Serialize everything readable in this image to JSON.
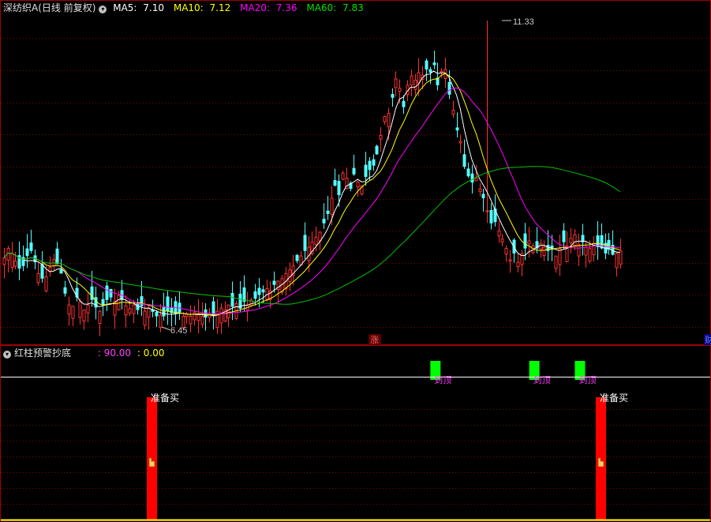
{
  "main_panel": {
    "title": "深纺织A(日线 前复权)",
    "ma_labels": [
      {
        "label": "MA5:",
        "value": "7.10",
        "color": "#ffffff"
      },
      {
        "label": "MA10:",
        "value": "7.12",
        "color": "#ffff00"
      },
      {
        "label": "MA20:",
        "value": "7.36",
        "color": "#ff00ff"
      },
      {
        "label": "MA60:",
        "value": "7.83",
        "color": "#00e000"
      }
    ],
    "high_marker": "11.33",
    "low_marker": "6.45",
    "zhang_label": "涨",
    "edge_label": "财"
  },
  "indicator_panel": {
    "title": "红柱预警抄底",
    "value1": ": 90.00",
    "value2": ": 0.00",
    "signal_top_label": "到顶",
    "signal_buy_label": "准备买"
  },
  "colors": {
    "up": "#ff3232",
    "down": "#54ffff",
    "ma5": "#ffffff",
    "ma10": "#ffff00",
    "ma20": "#ff00ff",
    "ma60": "#00c000",
    "grid": "#8b0000",
    "buy_bar": "#ff0000",
    "top_box": "#00ff00",
    "top_text": "#ff40ff"
  },
  "chart_data": {
    "type": "candlestick",
    "title": "深纺织A(日线 前复权)",
    "ylim": [
      6.2,
      11.6
    ],
    "close_series": [
      7.55,
      7.7,
      7.62,
      7.5,
      7.38,
      7.42,
      7.58,
      7.66,
      7.48,
      7.3,
      7.22,
      7.25,
      7.4,
      7.52,
      7.45,
      7.3,
      6.98,
      6.8,
      6.78,
      6.92,
      6.85,
      6.72,
      6.8,
      6.88,
      6.76,
      6.7,
      6.8,
      6.88,
      6.92,
      6.86,
      6.95,
      6.88,
      6.79,
      6.74,
      6.8,
      6.72,
      6.78,
      6.7,
      6.75,
      6.69,
      6.62,
      6.64,
      6.62,
      6.7,
      6.67,
      6.66,
      6.68,
      6.62,
      6.66,
      6.62,
      6.68,
      6.66,
      6.62,
      6.6,
      6.65,
      6.62,
      6.7,
      6.75,
      6.72,
      6.8,
      6.77,
      6.82,
      6.74,
      6.85,
      6.8,
      6.88,
      6.9,
      6.96,
      7.0,
      7.06,
      7.02,
      7.12,
      7.18,
      7.22,
      7.3,
      7.36,
      7.42,
      7.5,
      7.58,
      7.66,
      7.72,
      7.8,
      7.88,
      7.96,
      8.1,
      8.25,
      8.5,
      8.7,
      8.55,
      8.9,
      8.82,
      8.65,
      8.88,
      8.76,
      8.7,
      8.84,
      8.95,
      9.02,
      9.2,
      9.5,
      9.8,
      9.85,
      10.1,
      10.4,
      10.25,
      9.95,
      10.3,
      10.45,
      10.38,
      10.5,
      10.46,
      10.55,
      10.5,
      10.62,
      10.3,
      10.52,
      10.55,
      10.15,
      9.9,
      9.58,
      9.4,
      9.0,
      8.85,
      8.75,
      8.82,
      8.65,
      8.5,
      8.3,
      8.1,
      8.12,
      7.98,
      7.85,
      7.7,
      7.52,
      7.62,
      7.48,
      7.62,
      7.7,
      7.82,
      7.74,
      7.7,
      7.78,
      7.72,
      7.66,
      7.68,
      7.58,
      7.7,
      7.8,
      7.74,
      7.86,
      7.92,
      7.76,
      7.8,
      7.72,
      7.7,
      7.78,
      7.72,
      7.7,
      7.62,
      7.68,
      7.6,
      7.62,
      7.66
    ],
    "ma5": 7.1,
    "ma10": 7.12,
    "ma20": 7.36,
    "ma60": 7.83,
    "annotations": [
      {
        "label": "11.33",
        "kind": "high"
      },
      {
        "label": "6.45",
        "kind": "low"
      }
    ],
    "indicator": {
      "name": "红柱预警抄底",
      "values": [
        90.0,
        0.0
      ],
      "top_signal_days": [
        115,
        141,
        153
      ],
      "buy_signal_days": [
        44,
        187
      ],
      "top_signal_label": "到顶",
      "buy_signal_label": "准备买"
    }
  }
}
